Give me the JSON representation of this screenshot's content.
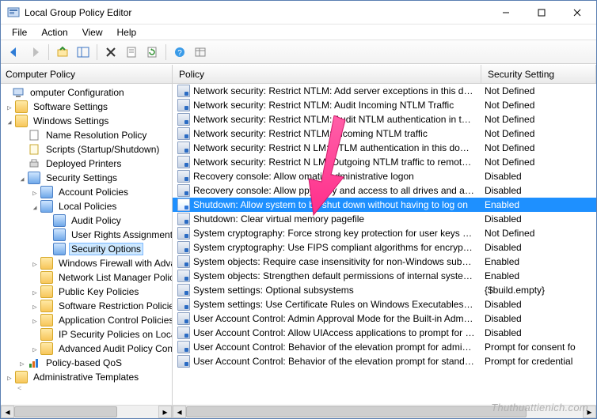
{
  "window": {
    "title": "Local Group Policy Editor",
    "min_tip": "Minimize",
    "max_tip": "Maximize",
    "close_tip": "Close"
  },
  "menu": {
    "file": "File",
    "action": "Action",
    "view": "View",
    "help": "Help"
  },
  "tree_header": "Computer Policy",
  "tree": {
    "root": "omputer Configuration",
    "software_settings": "Software Settings",
    "windows_settings": "Windows Settings",
    "name_resolution": "Name Resolution Policy",
    "scripts": "Scripts (Startup/Shutdown)",
    "deployed_printers": "Deployed Printers",
    "security_settings": "Security Settings",
    "account_policies": "Account Policies",
    "local_policies": "Local Policies",
    "audit_policy": "Audit Policy",
    "user_rights": "User Rights Assignment",
    "security_options": "Security Options",
    "firewall": "Windows Firewall with Advanced",
    "nlm": "Network List Manager Policie",
    "pubkey": "Public Key Policies",
    "srp": "Software Restriction Policies",
    "acp": "Application Control Policies",
    "ipsec": "IP Security Policies on Local",
    "aap": "Advanced Audit Policy Con",
    "qos": "Policy-based QoS",
    "admin_templates": "Administrative Templates"
  },
  "list_header": {
    "policy": "Policy",
    "security": "Security Setting"
  },
  "policies": [
    {
      "p": "Network security: Restrict NTLM: Add server exceptions in this domain",
      "s": "Not Defined"
    },
    {
      "p": "Network security: Restrict NTLM: Audit Incoming NTLM Traffic",
      "s": "Not Defined"
    },
    {
      "p": "Network security: Restrict NTLM: Audit NTLM authentication in this ...",
      "s": "Not Defined"
    },
    {
      "p": "Network security: Restrict NTLM: Incoming NTLM traffic",
      "s": "Not Defined"
    },
    {
      "p": "Network security: Restrict N    LM: NTLM authentication in this dom...",
      "s": "Not Defined"
    },
    {
      "p": "Network security: Restrict N    LM: Outgoing NTLM traffic to remote s...",
      "s": "Not Defined"
    },
    {
      "p": "Recovery console: Allow        omatic administrative logon",
      "s": "Disabled"
    },
    {
      "p": "Recovery console: Allow      ppy copy and access to all drives and all f...",
      "s": "Disabled"
    },
    {
      "p": "Shutdown: Allow system to be shut down without having to log on",
      "s": "Enabled",
      "sel": true
    },
    {
      "p": "Shutdown: Clear virtual memory pagefile",
      "s": "Disabled"
    },
    {
      "p": "System cryptography: Force strong key protection for user keys store...",
      "s": "Not Defined"
    },
    {
      "p": "System cryptography: Use FIPS compliant algorithms for encryption,...",
      "s": "Disabled"
    },
    {
      "p": "System objects: Require case insensitivity for non-Windows subsyste...",
      "s": "Enabled"
    },
    {
      "p": "System objects: Strengthen default permissions of internal system o...",
      "s": "Enabled"
    },
    {
      "p": "System settings: Optional subsystems",
      "s": "{$build.empty}"
    },
    {
      "p": "System settings: Use Certificate Rules on Windows Executables for So...",
      "s": "Disabled"
    },
    {
      "p": "User Account Control: Admin Approval Mode for the Built-in Admin...",
      "s": "Disabled"
    },
    {
      "p": "User Account Control: Allow UIAccess applications to prompt for ele...",
      "s": "Disabled"
    },
    {
      "p": "User Account Control: Behavior of the elevation prompt for administ...",
      "s": "Prompt for consent fo"
    },
    {
      "p": "User Account Control: Behavior of the elevation prompt for standard...",
      "s": "Prompt for credential"
    }
  ],
  "watermark": "Thuthuattienich.com"
}
